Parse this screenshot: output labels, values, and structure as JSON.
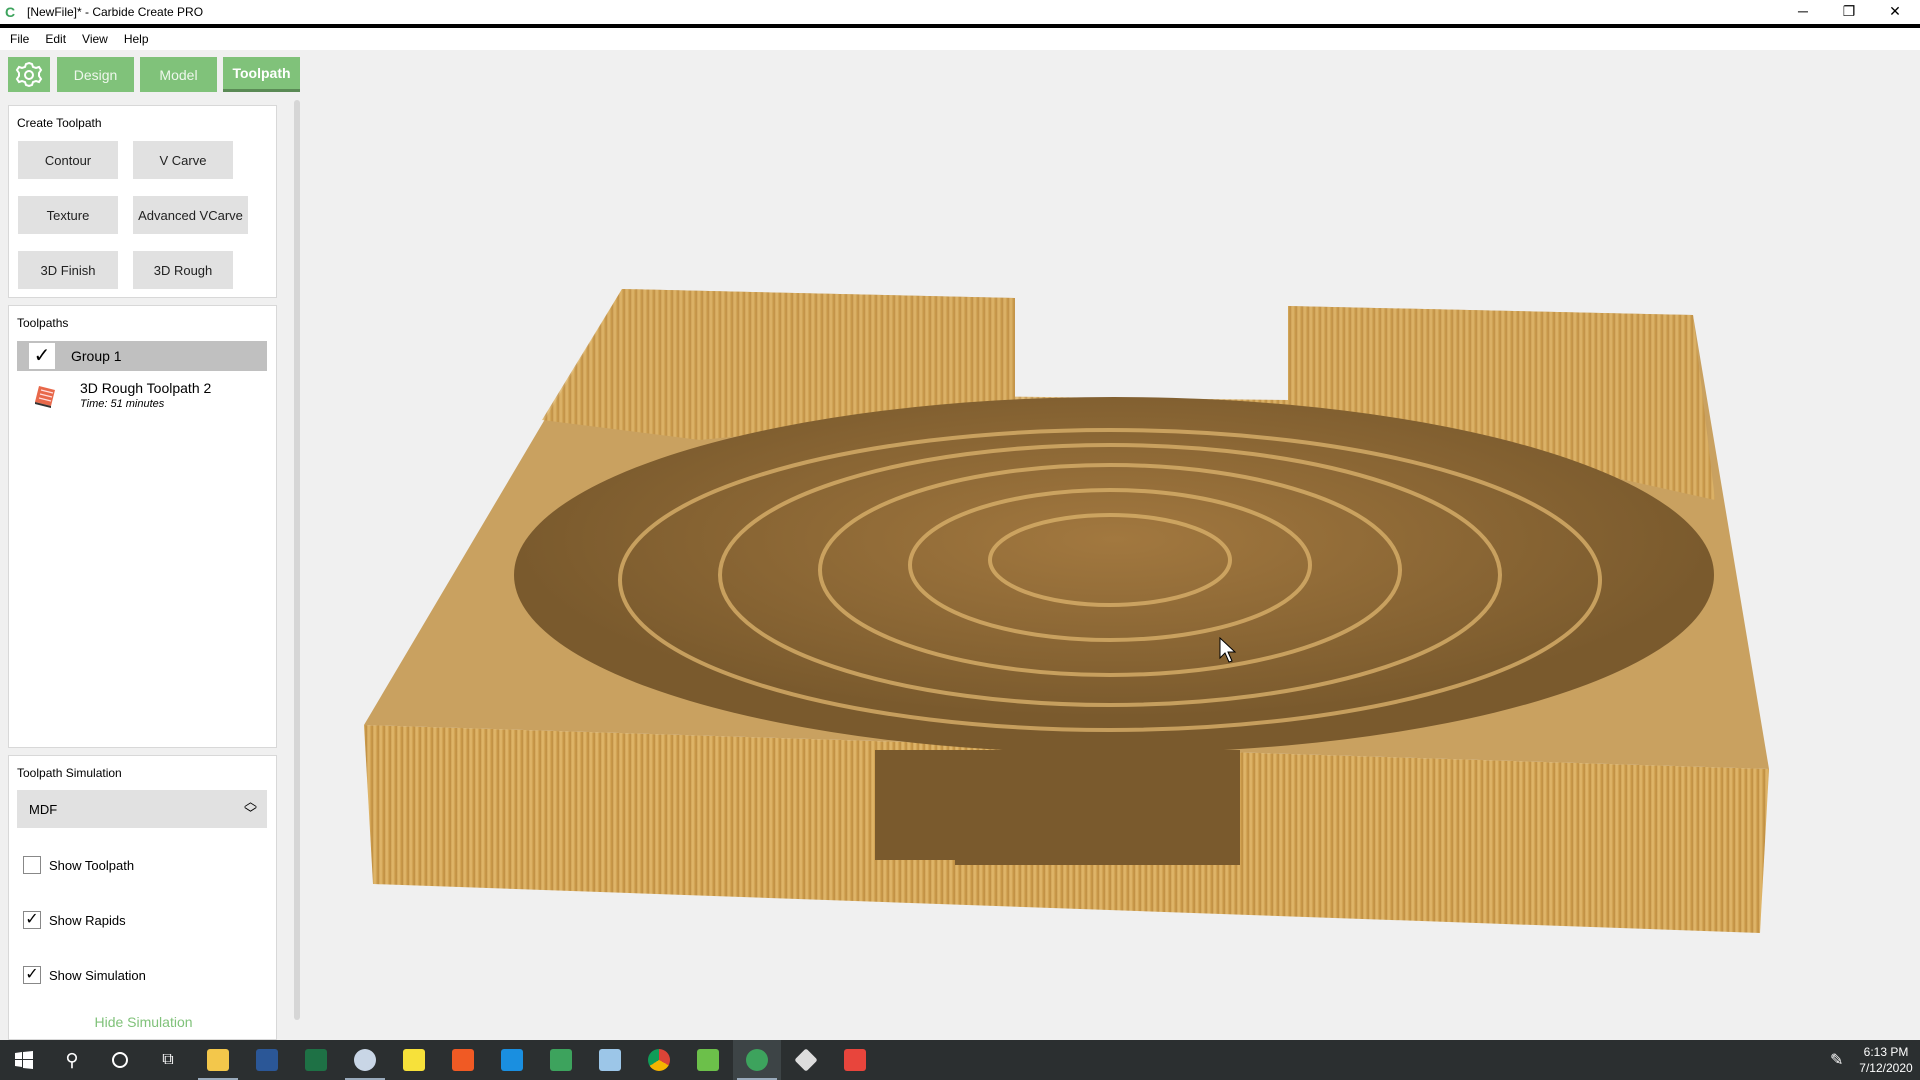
{
  "window": {
    "title": "[NewFile]* - Carbide Create PRO",
    "minimize": "─",
    "maximize": "❐",
    "close": "✕"
  },
  "menu": [
    "File",
    "Edit",
    "View",
    "Help"
  ],
  "tabs": {
    "design": "Design",
    "model": "Model",
    "toolpath": "Toolpath"
  },
  "create_toolpath": {
    "heading": "Create Toolpath",
    "buttons": [
      "Contour",
      "V Carve",
      "Texture",
      "Advanced VCarve",
      "3D Finish",
      "3D Rough"
    ]
  },
  "toolpaths": {
    "heading": "Toolpaths",
    "group": {
      "label": "Group 1",
      "checked": true
    },
    "items": [
      {
        "name": "3D Rough Toolpath 2",
        "time": "Time: 51 minutes"
      }
    ]
  },
  "simulation": {
    "heading": "Toolpath Simulation",
    "material": "MDF",
    "show_toolpath": {
      "label": "Show Toolpath",
      "checked": false
    },
    "show_rapids": {
      "label": "Show Rapids",
      "checked": true
    },
    "show_simulation": {
      "label": "Show Simulation",
      "checked": true
    },
    "hide_label": "Hide Simulation"
  },
  "colors": {
    "accent": "#80c27a",
    "taskbar": "#2b2f30"
  },
  "taskbar": {
    "time": "6:13 PM",
    "date": "7/12/2020"
  }
}
